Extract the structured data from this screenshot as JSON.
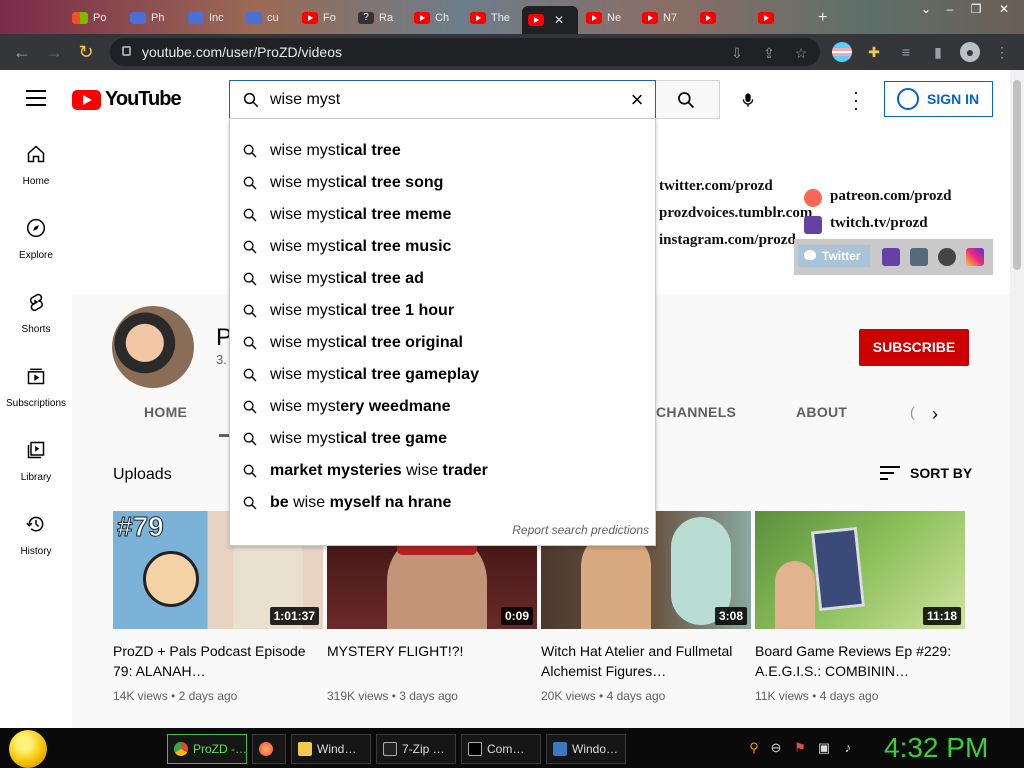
{
  "browser": {
    "tabs": [
      {
        "label": "Po",
        "icon": "windows-store-icon"
      },
      {
        "label": "Ph",
        "icon": "generic-page-icon"
      },
      {
        "label": "Inc",
        "icon": "generic-page-icon"
      },
      {
        "label": "cu",
        "icon": "generic-page-icon"
      },
      {
        "label": "Fo",
        "icon": "youtube-icon"
      },
      {
        "label": "Ra",
        "icon": "question-icon"
      },
      {
        "label": "Ch",
        "icon": "youtube-icon"
      },
      {
        "label": "The",
        "icon": "youtube-icon"
      },
      {
        "label": "",
        "icon": "youtube-icon",
        "active": true
      },
      {
        "label": "Ne",
        "icon": "youtube-icon"
      },
      {
        "label": "N7",
        "icon": "youtube-icon"
      },
      {
        "label": "",
        "icon": "youtube-icon"
      },
      {
        "label": "",
        "icon": "youtube-icon"
      }
    ],
    "url": "youtube.com/user/ProZD/videos",
    "new_tab": "+"
  },
  "youtube": {
    "logo_text": "YouTube",
    "search": {
      "value": "wise myst"
    },
    "signin_label": "SIGN IN",
    "sidebar": [
      {
        "label": "Home",
        "icon": "home-icon"
      },
      {
        "label": "Explore",
        "icon": "compass-icon"
      },
      {
        "label": "Shorts",
        "icon": "shorts-icon"
      },
      {
        "label": "Subscriptions",
        "icon": "subscriptions-icon"
      },
      {
        "label": "Library",
        "icon": "library-icon"
      },
      {
        "label": "History",
        "icon": "history-icon"
      }
    ],
    "suggestions": [
      {
        "pre": "wise myst",
        "rest": "ical tree"
      },
      {
        "pre": "wise myst",
        "rest": "ical tree song"
      },
      {
        "pre": "wise myst",
        "rest": "ical tree meme"
      },
      {
        "pre": "wise myst",
        "rest": "ical tree music"
      },
      {
        "pre": "wise myst",
        "rest": "ical tree ad"
      },
      {
        "pre": "wise myst",
        "rest": "ical tree 1 hour"
      },
      {
        "pre": "wise myst",
        "rest": "ical tree original"
      },
      {
        "pre": "wise myst",
        "rest": "ical tree gameplay"
      },
      {
        "pre": "wise myst",
        "rest": "ery weedmane"
      },
      {
        "pre": "wise myst",
        "rest": "ical tree game"
      },
      {
        "a": "market mysteries ",
        "b": "wise",
        "c": " trader"
      },
      {
        "a": "be ",
        "b": "wise",
        "c": " myself na hrane"
      }
    ],
    "report_label": "Report search predictions",
    "banner": {
      "twitter": "twitter.com/prozd",
      "tumblr": "prozdvoices.tumblr.com",
      "instagram": "instagram.com/prozd",
      "patreon": "patreon.com/prozd",
      "twitch": "twitch.tv/prozd",
      "twitter_button": "Twitter"
    },
    "channel": {
      "name_partial": "P",
      "subs_partial": "3.",
      "subscribe_label": "SUBSCRIBE",
      "tabs": [
        "HOME",
        "CHANNELS",
        "ABOUT"
      ],
      "more_tab_partial": "("
    },
    "uploads_label": "Uploads",
    "sort_label": "SORT BY",
    "videos": [
      {
        "title": "ProZD + Pals Podcast Episode 79: ALANAH…",
        "duration": "1:01:37",
        "views": "14K views",
        "age": "2 days ago",
        "badge": "#79"
      },
      {
        "title": "MYSTERY FLIGHT!?!",
        "duration": "0:09",
        "views": "319K views",
        "age": "3 days ago"
      },
      {
        "title": "Witch Hat Atelier and Fullmetal Alchemist Figures…",
        "duration": "3:08",
        "views": "20K views",
        "age": "4 days ago"
      },
      {
        "title": "Board Game Reviews Ep #229: A.E.G.I.S.: COMBININ…",
        "duration": "11:18",
        "views": "11K views",
        "age": "4 days ago"
      }
    ]
  },
  "taskbar": {
    "items": [
      {
        "label": "ProZD -…",
        "active": true
      },
      {
        "label": ""
      },
      {
        "label": "Wind…"
      },
      {
        "label": "7-Zip …"
      },
      {
        "label": "Com…"
      },
      {
        "label": "Windo…"
      }
    ],
    "clock": "4:32 PM"
  },
  "colors": {
    "youtube_red": "#ff0000",
    "link_blue": "#065fd4",
    "subscribe_red": "#cc0000",
    "clock_green": "#34d234"
  }
}
